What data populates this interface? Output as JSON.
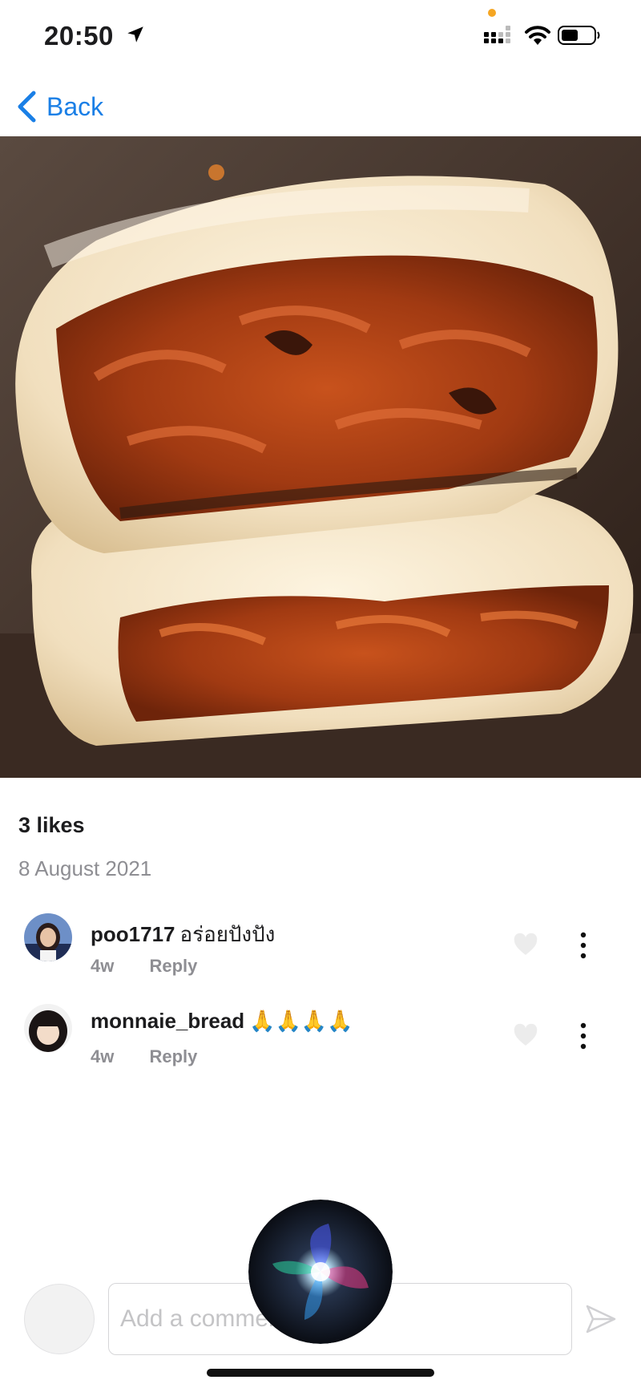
{
  "status_bar": {
    "time": "20:50",
    "icons": [
      "location-arrow-icon",
      "signal-icon",
      "wifi-icon",
      "battery-icon"
    ],
    "camera_dot_color": "#f5a623"
  },
  "nav": {
    "back_label": "Back",
    "back_icon": "chevron-left-icon",
    "accent_color": "#1a7fe6"
  },
  "post": {
    "photo_subject": "food photo",
    "likes_label": "3 likes",
    "date": "8 August 2021"
  },
  "comments": [
    {
      "username": "poo1717",
      "text": "อร่อยปังปัง",
      "time": "4w",
      "reply_label": "Reply"
    },
    {
      "username": "monnaie_bread",
      "text": "🙏🙏🙏🙏",
      "time": "4w",
      "reply_label": "Reply"
    }
  ],
  "composer": {
    "placeholder": "Add a comment...",
    "send_icon": "send-icon"
  },
  "overlay": {
    "assistant_icon": "siri-orb-icon"
  }
}
